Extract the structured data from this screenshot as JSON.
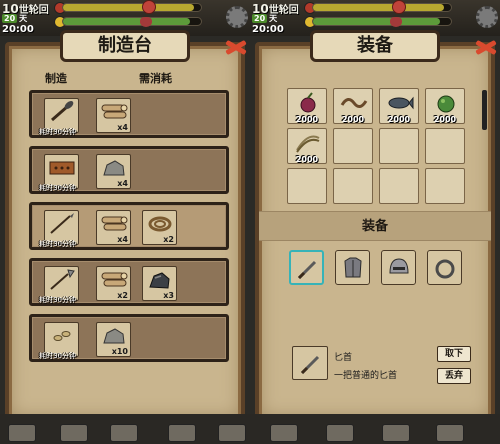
{
  "hud": {
    "day_count": "10",
    "world_label": "世轮回",
    "days_badge": "20",
    "days_unit": "天",
    "time": "20:00",
    "bar1_percent": 95,
    "bar2_percent": 92
  },
  "crafting": {
    "title": "制造台",
    "col_make": "制造",
    "col_consume": "需消耗",
    "recipes": [
      {
        "product_icon": "club-icon",
        "cost": "耗时30分钟",
        "materials": [
          {
            "icon": "wood-logs-icon",
            "qty": "x4"
          }
        ]
      },
      {
        "product_icon": "brick-icon",
        "cost": "耗时30分钟",
        "materials": [
          {
            "icon": "stone-icon",
            "qty": "x4"
          }
        ]
      },
      {
        "product_icon": "spear-icon",
        "cost": "耗时30分钟",
        "materials": [
          {
            "icon": "wood-logs-icon",
            "qty": "x4"
          },
          {
            "icon": "rope-icon",
            "qty": "x2"
          }
        ]
      },
      {
        "product_icon": "arrow-icon",
        "cost": "耗时30分钟",
        "materials": [
          {
            "icon": "wood-logs-icon",
            "qty": "x2"
          },
          {
            "icon": "iron-ore-icon",
            "qty": "x3"
          }
        ]
      },
      {
        "product_icon": "seeds-icon",
        "cost": "耗时30分钟",
        "materials": [
          {
            "icon": "stone-icon",
            "qty": "x10"
          }
        ]
      }
    ]
  },
  "equipment": {
    "title": "装备",
    "inventory": [
      {
        "icon": "berry-icon",
        "count": "2000"
      },
      {
        "icon": "worm-icon",
        "count": "2000"
      },
      {
        "icon": "fish-icon",
        "count": "2000"
      },
      {
        "icon": "herb-icon",
        "count": "2000"
      },
      {
        "icon": "fiber-icon",
        "count": "2000"
      }
    ],
    "section_label": "装备",
    "slots": [
      "dagger-icon",
      "armor-icon",
      "helmet-icon",
      "ring-icon"
    ],
    "detail": {
      "name": "匕首",
      "description": "一把普通的匕首",
      "unequip_label": "取下",
      "discard_label": "丢弃"
    }
  }
}
